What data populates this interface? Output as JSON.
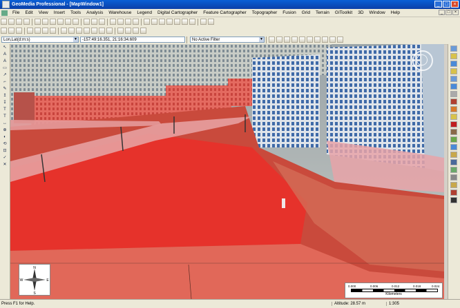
{
  "window": {
    "title": "GeoMedia Professional - [MapWindow1]",
    "controls": [
      "_",
      "□",
      "×"
    ],
    "mdi_controls": [
      "_",
      "□",
      "×"
    ]
  },
  "menu": [
    "File",
    "Edit",
    "View",
    "Insert",
    "Tools",
    "Analysis",
    "Warehouse",
    "Legend",
    "Digital Cartographer",
    "Feature Cartographer",
    "Topographer",
    "Fusion",
    "Grid",
    "Terrain",
    "GIToolkit",
    "3D",
    "Window",
    "Help"
  ],
  "toolbar": {
    "coord_system": "Lon,Lat(d:m:s)",
    "coordinate_readout": "-157:49:16.351, 21:16:34.609",
    "filter": "No Active Filter"
  },
  "status": {
    "help": "Press F1 for Help.",
    "altitude": "Altitude: 28.57 m",
    "scale": "1:305"
  },
  "scalebar": {
    "labels": [
      "0.000",
      "0.006",
      "0.012",
      "0.018",
      "0.024"
    ],
    "units": "Kilometers"
  },
  "compass": {
    "n": "N",
    "s": "S",
    "e": "E",
    "w": "W"
  },
  "left_tools": [
    "↖",
    "A",
    "A",
    "▭",
    "↗",
    "⌐",
    "✎",
    "↥",
    "↧",
    "T",
    "T",
    "↔",
    "⊕",
    "◐",
    "⟲",
    "⊡",
    "✓",
    "✕"
  ],
  "colors": {
    "overlay_red": "#e8302a",
    "titlebar": "#0b52c8",
    "ui_face": "#ece9d8"
  }
}
